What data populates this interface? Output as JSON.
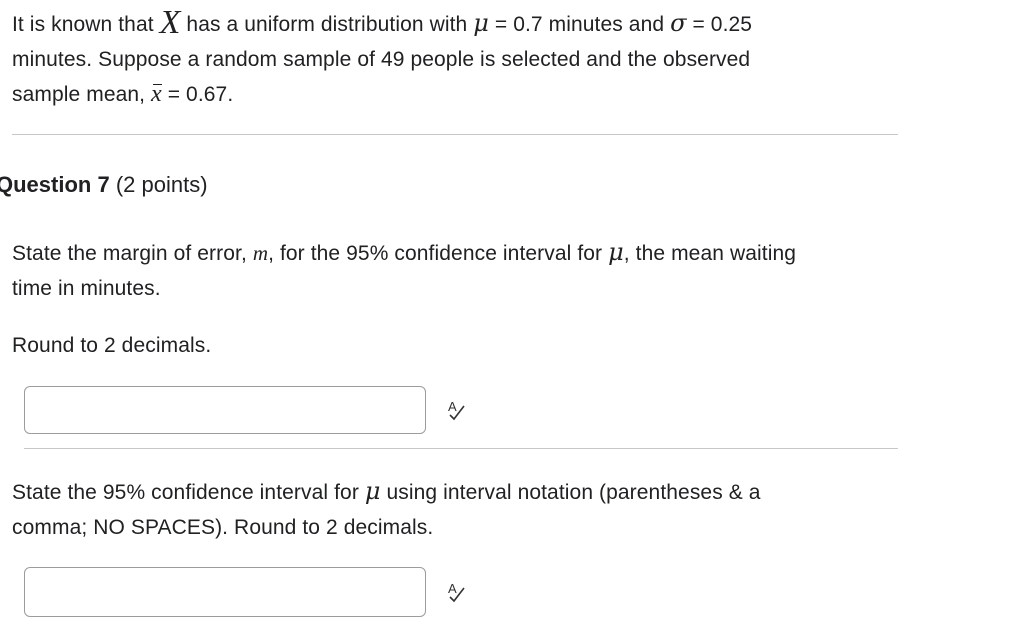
{
  "intro": {
    "part1": "It is known that",
    "var_x": "X",
    "part2": "has a uniform distribution with",
    "mu": "μ",
    "mu_value": "= 0.7 minutes and",
    "sigma": "σ",
    "sigma_value": "= 0.25",
    "line2": "minutes. Suppose a random sample of 49 people is selected and the observed",
    "line3_prefix": "sample mean,",
    "xbar": "x",
    "xbar_value": "= 0.67."
  },
  "question": {
    "title_bold": "Question 7",
    "points": "(2 points)"
  },
  "part_a": {
    "line1_prefix": "State the margin of error,",
    "m": "m",
    "line1_mid": ", for the 95% confidence interval for",
    "mu": "μ",
    "line1_suffix": ", the mean waiting",
    "line2": "time in minutes.",
    "round": "Round to 2 decimals.",
    "answer_value": "",
    "answer_placeholder": ""
  },
  "part_b": {
    "line1_prefix": "State the 95% confidence interval for",
    "mu": "μ",
    "line1_suffix": "using interval notation (parentheses & a",
    "line2": "comma; NO SPACES). Round to 2 decimals.",
    "answer_value": "",
    "answer_placeholder": ""
  },
  "icons": {
    "spellcheck": "spellcheck-icon"
  }
}
